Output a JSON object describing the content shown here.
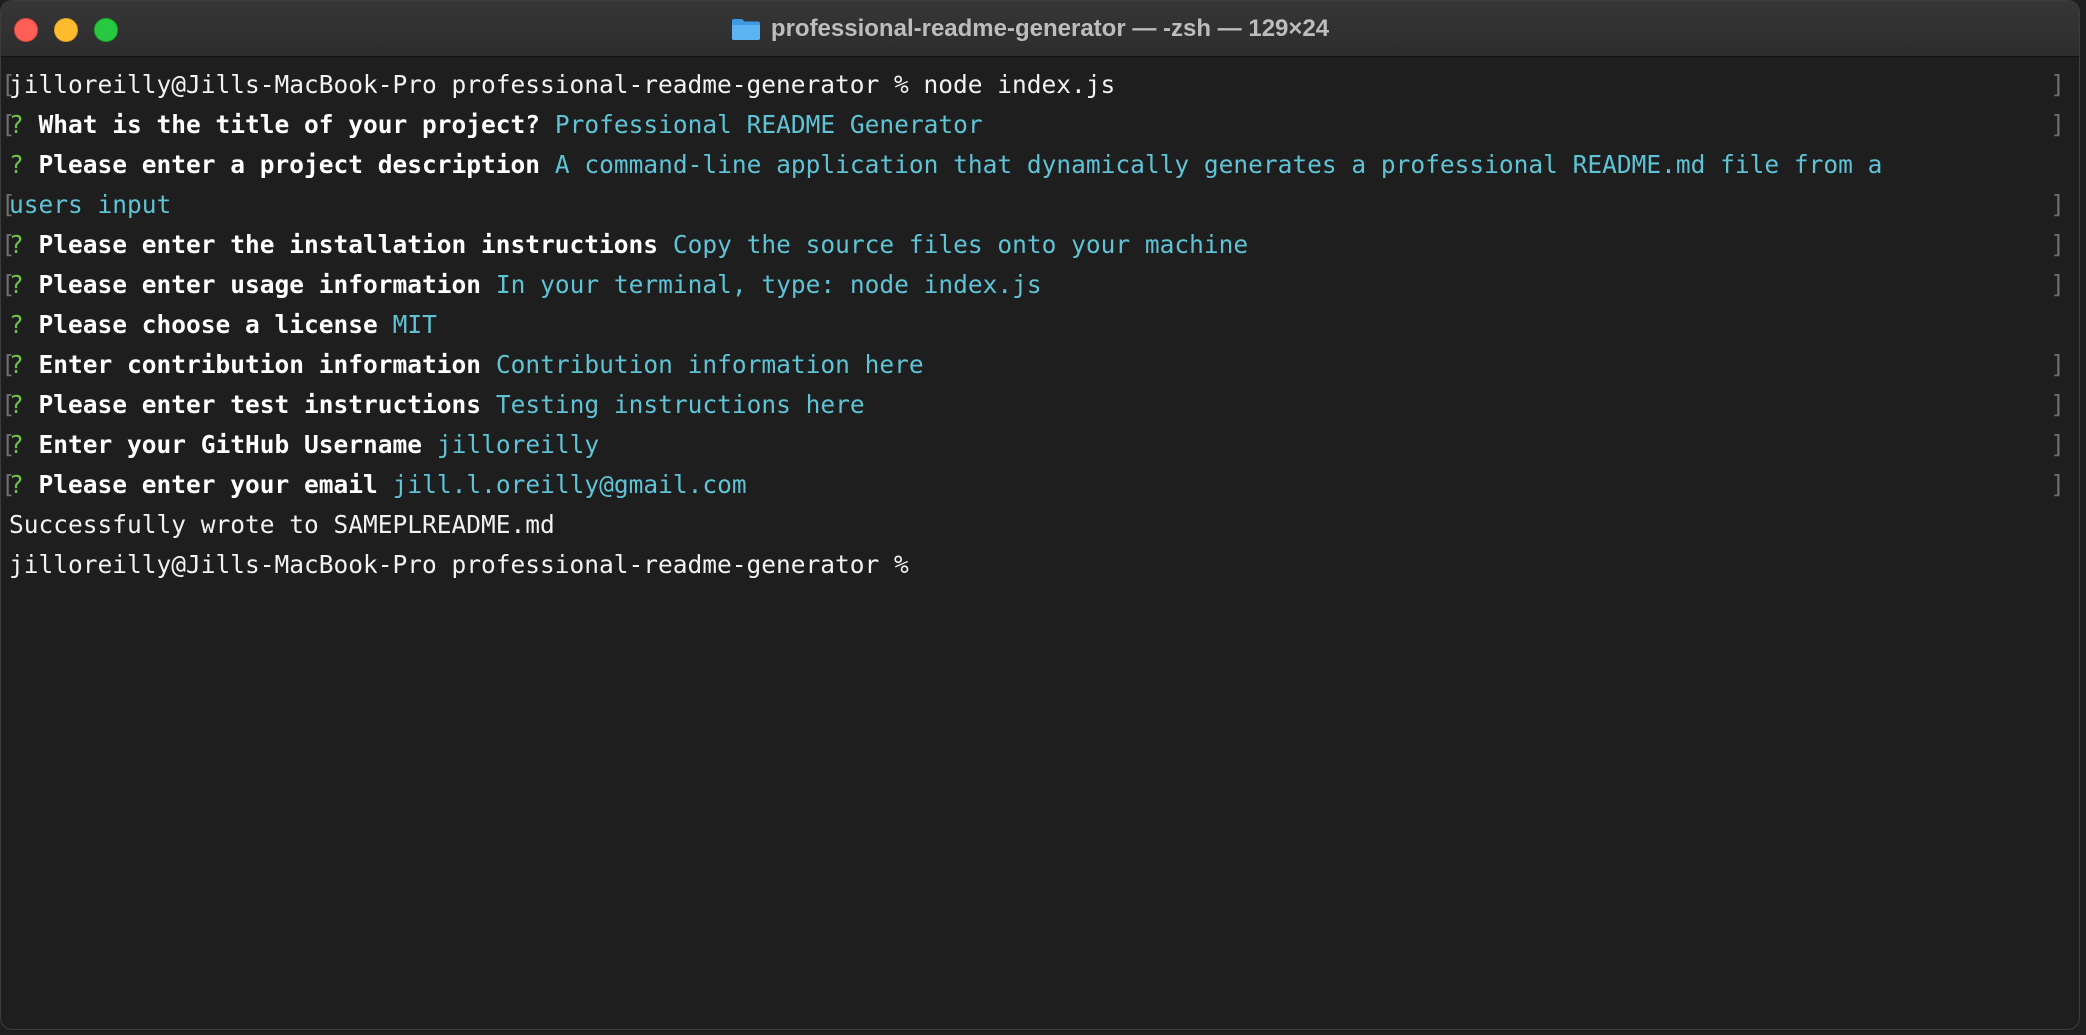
{
  "window": {
    "title": "professional-readme-generator — -zsh — 129×24"
  },
  "terminal": {
    "first_command": "jilloreilly@Jills-MacBook-Pro professional-readme-generator % node index.js",
    "questions": [
      {
        "mark": "?",
        "prompt": "What is the title of your project?",
        "answer": "Professional README Generator"
      },
      {
        "mark": "?",
        "prompt": "Please enter a project description",
        "answer": "A command-line application that dynamically generates a professional README.md file from a",
        "answer_continued": "users input"
      },
      {
        "mark": "?",
        "prompt": "Please enter the installation instructions",
        "answer": "Copy the source files onto your machine"
      },
      {
        "mark": "?",
        "prompt": "Please enter usage information",
        "answer": "In your terminal, type: node index.js"
      },
      {
        "mark": "?",
        "prompt": "Please choose a license",
        "answer": "MIT"
      },
      {
        "mark": "?",
        "prompt": "Enter contribution information",
        "answer": "Contribution information here"
      },
      {
        "mark": "?",
        "prompt": "Please enter test instructions",
        "answer": "Testing instructions here"
      },
      {
        "mark": "?",
        "prompt": "Enter your GitHub Username",
        "answer": "jilloreilly"
      },
      {
        "mark": "?",
        "prompt": "Please enter your email",
        "answer": "jill.l.oreilly@gmail.com"
      }
    ],
    "success_message": "Successfully wrote to SAMEPLREADME.md",
    "final_prompt": "jilloreilly@Jills-MacBook-Pro professional-readme-generator %"
  },
  "colors": {
    "background": "#1e1e1e",
    "prompt_mark": "#6cc24a",
    "answer": "#5fc3d6",
    "prompt_text": "#ffffff"
  },
  "icons": {
    "title_icon": "folder-icon"
  }
}
